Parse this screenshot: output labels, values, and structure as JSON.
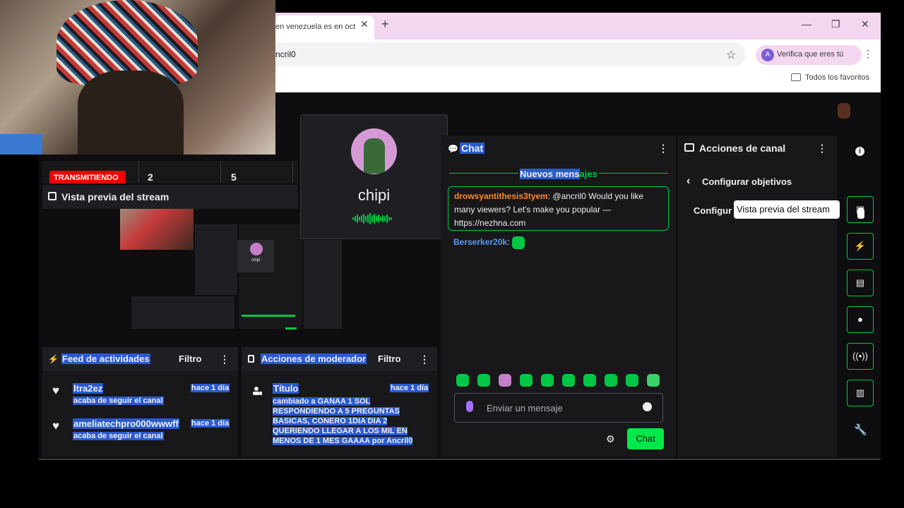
{
  "browser": {
    "tab_title": "en venezuela es en oct",
    "tab_close": "✕",
    "new_tab": "+",
    "minimize": "—",
    "restore": "❐",
    "close": "✕",
    "address": "ncril0",
    "verify_label": "Verifica que eres tú",
    "verify_initial": "A",
    "favorites_label": "Todos los favoritos"
  },
  "stats": {
    "live_label": "TRANSMITIENDO",
    "stat1": "2",
    "stat2": "5"
  },
  "preview": {
    "title": "Vista previa del stream",
    "thumb_name": "chipi"
  },
  "call": {
    "name": "chipi"
  },
  "chat": {
    "title": "Chat",
    "new_messages_a": "Nuevos mens",
    "new_messages_b": "ajes",
    "messages": [
      {
        "user": "drowsyantithesis3tyem",
        "text": ": @ancril0 Would you like many viewers? Let's make you popular — https://nezhna.com"
      },
      {
        "user": "Berserker20k",
        "text": ": "
      }
    ],
    "input_placeholder": "Enviar un mensaje",
    "send_label": "Chat"
  },
  "actions": {
    "title": "Acciones de canal",
    "back_label": "Configurar objetivos",
    "config_label": "Configur",
    "tooltip": "Vista previa del stream"
  },
  "feed": {
    "title": "Feed de actividades",
    "filter": "Filtro",
    "items": [
      {
        "user": "ltra2ez",
        "desc": "acaba de seguir el canal",
        "time": "hace 1 día"
      },
      {
        "user": "ameliatechpro000wwwff",
        "desc": "acaba de seguir el canal",
        "time": "hace 1 día"
      }
    ]
  },
  "mod": {
    "title": "Acciones de moderador",
    "filter": "Filtro",
    "item_title": "Título",
    "item_time": "hace 1 día",
    "item_body": "cambiado a GANAA 1 SOL RESPONDIENDO A 5 PREGUNTAS BASICAS, CONERO 1DIA DIA 2 QUERIENDO LLEGAR A LOS MIL EN MENOS DE 1 MES GAAAA por Ancril0"
  },
  "icons": {
    "chat": "chat-bubble-icon",
    "info": "info-icon",
    "wrench": "wrench-icon",
    "gear": "gear-icon",
    "heart": "heart-icon"
  },
  "colors": {
    "accent_green": "#00c846",
    "highlight_blue": "#2a5ad0",
    "live_red": "#eb0400",
    "username_orange": "#ff8a2a",
    "username_blue": "#5a9af0"
  }
}
